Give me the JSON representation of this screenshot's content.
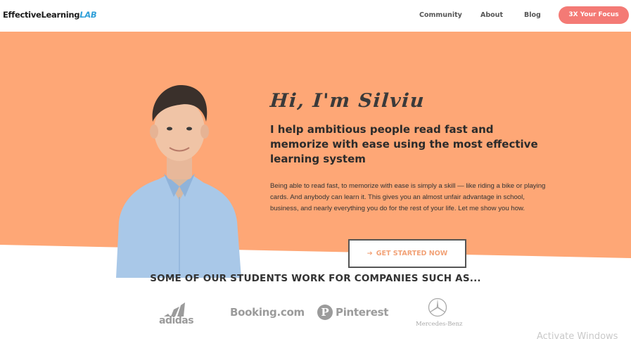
{
  "header": {
    "logo_main": "EffectiveLearning",
    "logo_accent": "LAB",
    "nav": [
      "Community",
      "About",
      "Blog"
    ],
    "cta": "3X Your Focus"
  },
  "hero": {
    "title": "Hi, I'm Silviu",
    "subtitle_bold": "I help ambitious people read fast and memorize with ease using the most effective learning system",
    "body": "Being able to read fast, to memorize with ease is simply a skill — like riding a bike or playing cards. And anybody can learn it. This gives you an almost unfair advantage in school, business, and nearly everything you do for the rest of your life. Let me show you how.",
    "cta": "GET STARTED NOW",
    "cta_icon": "arrow-right-icon"
  },
  "companies": {
    "title": "SOME OF OUR STUDENTS WORK FOR COMPANIES SUCH AS...",
    "logos": [
      "adidas",
      "Booking.com",
      "Pinterest",
      "Mercedes-Benz"
    ]
  },
  "watermark": "Activate Windows",
  "colors": {
    "hero_bg": "#fea776",
    "accent_pink": "#f47a75",
    "logo_blue": "#2f9fd8",
    "cta_text": "#f2a277",
    "logo_gray": "#9b9b9b"
  }
}
